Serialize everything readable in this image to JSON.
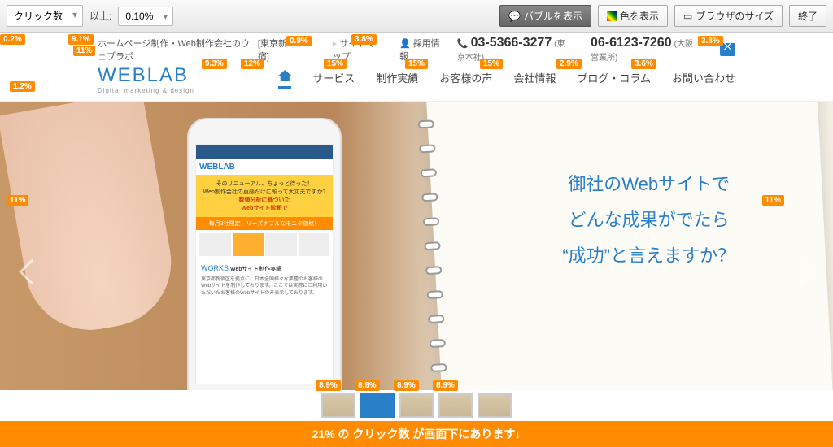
{
  "toolbar": {
    "metric": "クリック数",
    "threshold_label": "以上:",
    "threshold_value": "0.10%",
    "bubble_btn": "バブルを表示",
    "color_btn": "色を表示",
    "browser_btn": "ブラウザのサイズ",
    "exit_btn": "終了"
  },
  "badges": {
    "b1": "0.2%",
    "b2": "9.1%",
    "b3": "11%",
    "b4": "0.9%",
    "b5": "3.8%",
    "b6": "3.8%",
    "b7": "9.3%",
    "b8": "12%",
    "b9": "15%",
    "b10": "15%",
    "b11": "15%",
    "b12": "2.9%",
    "b13": "3.6%",
    "b14": "1.2%",
    "b15": "11%",
    "b16": "11%",
    "t1": "8.9%",
    "t2": "8.9%",
    "t3": "8.9%",
    "t4": "8.9%"
  },
  "site": {
    "tagline": "ホームページ制作・Web制作会社のウェブラボ",
    "location": "[東京新宿]",
    "sitemap": "サイトマップ",
    "recruit": "採用情報",
    "phone1": "03-5366-3277",
    "phone1_loc": "(東京本社)",
    "phone2": "06-6123-7260",
    "phone2_loc": "(大阪営業所)",
    "logo": "WEBLAB",
    "logo_sub": "Digital marketing & design"
  },
  "nav": {
    "n1": "サービス",
    "n2": "制作実績",
    "n3": "お客様の声",
    "n4": "会社情報",
    "n5": "ブログ・コラム",
    "n6": "お問い合わせ"
  },
  "hero": {
    "line1": "御社のWebサイトで",
    "line2": "どんな成果がでたら",
    "line3": "“成功”と言えますか？"
  },
  "phone_content": {
    "logo": "WEBLAB",
    "banner1": "そのリニューアル、ちょっと待った！",
    "banner2": "Web制作会社の直感だけに頼って大丈夫ですか?",
    "banner3": "数値分析に基づいた",
    "banner4": "Webサイト診断で",
    "orange": "毎月3社限定！リーズナブルなモニタ価格！",
    "works": "WORKS",
    "works_sub": "Webサイト制作実績",
    "works_text": "東京都新宿区を拠点に、日本全国様々な業種のお客様のWebサイトを制作しております。ここでは実際にご利用いただいたお客様のWebサイトのみ表示しております。"
  },
  "footer": "21% の クリック数 が画面下にあります↓"
}
